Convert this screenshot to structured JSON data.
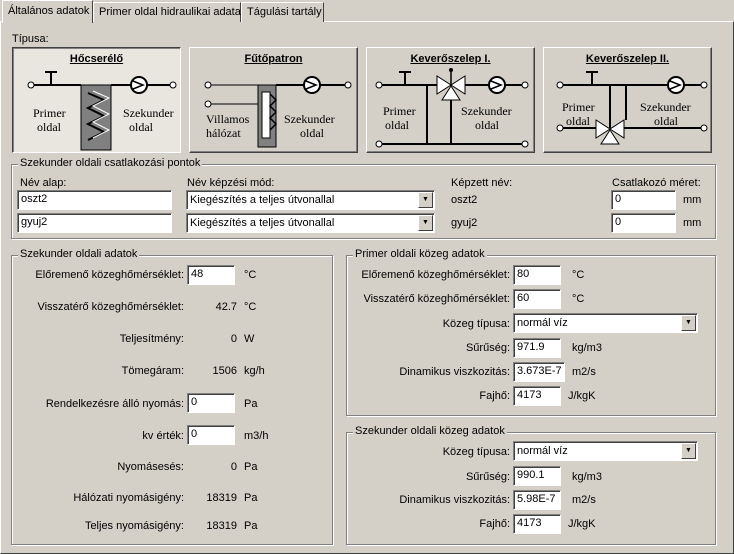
{
  "tabs": [
    "Általános adatok",
    "Primer oldal hidraulikai adatai",
    "Tágulási tartály"
  ],
  "tipusa_label": "Típusa:",
  "types": [
    {
      "title": "Hőcserélő",
      "left": "Primer",
      "left2": "oldal",
      "right": "Szekunder",
      "right2": "oldal"
    },
    {
      "title": "Fűtőpatron",
      "left": "Villamos",
      "left2": "hálózat",
      "right": "Szekunder",
      "right2": "oldal"
    },
    {
      "title": "Keverőszelep I.",
      "left": "Primer",
      "left2": "oldal",
      "right": "Szekunder",
      "right2": "oldal"
    },
    {
      "title": "Keverőszelep II.",
      "left": "Primer",
      "left2": "oldal",
      "right": "Szekunder",
      "right2": "oldal"
    }
  ],
  "connection": {
    "title": "Szekunder oldali csatlakozási pontok",
    "col_name": "Név alap:",
    "col_mode": "Név képzési mód:",
    "col_generated": "Képzett név:",
    "col_size": "Csatlakozó méret:",
    "rows": [
      {
        "name": "oszt2",
        "mode": "Kiegészítés a teljes útvonallal",
        "generated": "oszt2",
        "size": "0",
        "unit": "mm"
      },
      {
        "name": "gyuj2",
        "mode": "Kiegészítés a teljes útvonallal",
        "generated": "gyuj2",
        "size": "0",
        "unit": "mm"
      }
    ]
  },
  "secondary": {
    "title": "Szekunder oldali adatok",
    "flow_temp_label": "Előremenő közeghőmérséklet:",
    "flow_temp_value": "48",
    "flow_temp_unit": "°C",
    "return_temp_label": "Visszatérő közeghőmérséklet:",
    "return_temp_value": "42.7",
    "return_temp_unit": "°C",
    "power_label": "Teljesítmény:",
    "power_value": "0",
    "power_unit": "W",
    "mass_flow_label": "Tömegáram:",
    "mass_flow_value": "1506",
    "mass_flow_unit": "kg/h",
    "available_pressure_label": "Rendelkezésre álló nyomás:",
    "available_pressure_value": "0",
    "available_pressure_unit": "Pa",
    "kv_label": "kv érték:",
    "kv_value": "0",
    "kv_unit": "m3/h",
    "pressure_drop_label": "Nyomásesés:",
    "pressure_drop_value": "0",
    "pressure_drop_unit": "Pa",
    "network_pressure_label": "Hálózati nyomásigény:",
    "network_pressure_value": "18319",
    "network_pressure_unit": "Pa",
    "total_pressure_label": "Teljes nyomásigény:",
    "total_pressure_value": "18319",
    "total_pressure_unit": "Pa"
  },
  "primary_medium": {
    "title": "Primer oldali közeg adatok",
    "flow_temp_label": "Előremenő közeghőmérséklet:",
    "flow_temp_value": "80",
    "flow_temp_unit": "°C",
    "return_temp_label": "Visszatérő közeghőmérséklet:",
    "return_temp_value": "60",
    "return_temp_unit": "°C",
    "type_label": "Közeg típusa:",
    "type_value": "normál víz",
    "density_label": "Sűrűség:",
    "density_value": "971.9",
    "density_unit": "kg/m3",
    "viscosity_label": "Dinamikus viszkozitás:",
    "viscosity_value": "3.673E-7",
    "viscosity_unit": "m2/s",
    "heat_label": "Fajhő:",
    "heat_value": "4173",
    "heat_unit": "J/kgK"
  },
  "secondary_medium": {
    "title": "Szekunder oldali közeg adatok",
    "type_label": "Közeg típusa:",
    "type_value": "normál víz",
    "density_label": "Sűrűség:",
    "density_value": "990.1",
    "density_unit": "kg/m3",
    "viscosity_label": "Dinamikus viszkozitás:",
    "viscosity_value": "5.98E-7",
    "viscosity_unit": "m2/s",
    "heat_label": "Fajhő:",
    "heat_value": "4173",
    "heat_unit": "J/kgK"
  }
}
